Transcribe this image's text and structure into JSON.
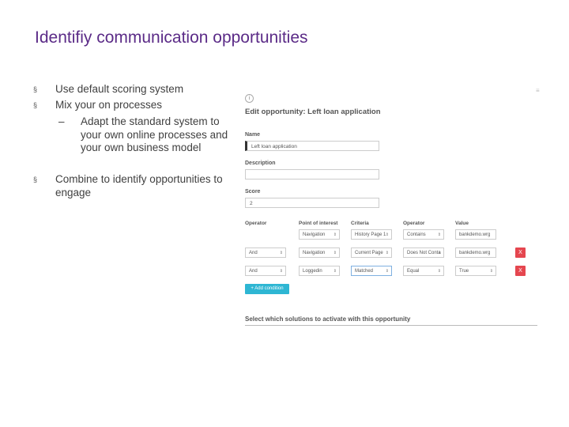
{
  "slide": {
    "title": "Identifiy communication opportunities",
    "bullets": [
      "Use default scoring system",
      "Mix your on processes",
      "Combine to identify opportunities to engage"
    ],
    "sub_bullet": "Adapt the standard system to your own online processes and your own business model",
    "bullet_marker": "§",
    "sub_marker": "–"
  },
  "form": {
    "info_icon": "i",
    "menu_icon": "≡",
    "title": "Edit opportunity: Left loan application",
    "name_label": "Name",
    "name_value": "Left loan application",
    "description_label": "Description",
    "description_value": "",
    "score_label": "Score",
    "score_value": "2",
    "columns": [
      "Operator",
      "Point of interest",
      "Criteria",
      "Operator",
      "Value"
    ],
    "rows": [
      {
        "op": "",
        "poi": "Navigation",
        "criteria": "History Page 1",
        "operator": "Contains",
        "value": "bankdemo.wrg"
      },
      {
        "op": "And",
        "poi": "Navigation",
        "criteria": "Current Page",
        "operator": "Does Not Conta",
        "value": "bankdemo.wrg"
      },
      {
        "op": "And",
        "poi": "Loggedin",
        "criteria": "Matched",
        "operator": "Equal",
        "value": "True"
      }
    ],
    "delete_label": "X",
    "add_condition_label": "+ Add condition",
    "solutions_title": "Select which solutions to activate with this opportunity"
  }
}
